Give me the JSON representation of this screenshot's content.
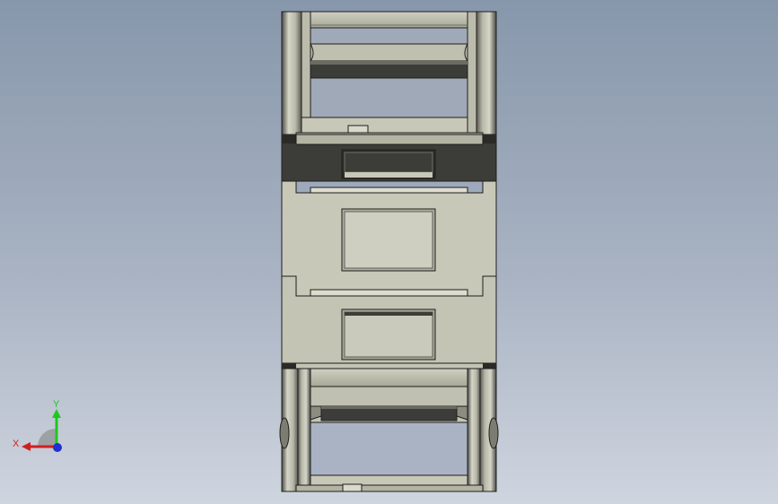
{
  "view": {
    "background_top": "#8797ab",
    "background_bottom": "#cfd5df"
  },
  "model": {
    "description_icon": "drag-chain-link-icon",
    "colors": {
      "light": "#c8c8b8",
      "mid": "#a8a898",
      "dark": "#3c3d38",
      "edge": "#1e1e1c"
    }
  },
  "triad": {
    "x_label": "X",
    "y_label": "Y",
    "x_color": "#d21e1e",
    "y_color": "#1ec81e",
    "z_color": "#1e32d2"
  }
}
